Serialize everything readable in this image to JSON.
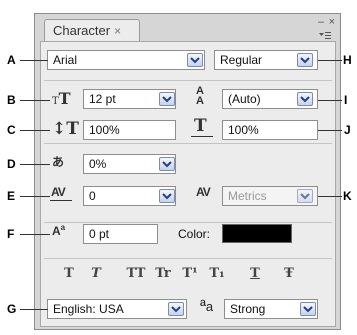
{
  "panel": {
    "tab_title": "Character",
    "tab_close": "×",
    "close": "×",
    "minimize": "–",
    "menu_icon": "panel-menu-icon"
  },
  "font": {
    "family": "Arial",
    "style": "Regular"
  },
  "size": {
    "font_size": "12 pt",
    "leading": "(Auto)"
  },
  "scale": {
    "vertical": "100%",
    "horizontal": "100%"
  },
  "tsume": {
    "value": "0%"
  },
  "kerning": {
    "tracking": "0",
    "kerning": "Metrics"
  },
  "baseline": {
    "shift": "0 pt",
    "color_label": "Color:",
    "color": "#000000"
  },
  "styles": [
    "T",
    "T",
    "TT",
    "Tr",
    "T¹",
    "T₁",
    "T",
    "Ŧ"
  ],
  "language": {
    "value": "English: USA",
    "aa_label": "ª",
    "aa_sub": "a",
    "antialias": "Strong"
  },
  "callouts": {
    "A": "A",
    "B": "B",
    "C": "C",
    "D": "D",
    "E": "E",
    "F": "F",
    "G": "G",
    "H": "H",
    "I": "I",
    "J": "J",
    "K": "K"
  }
}
